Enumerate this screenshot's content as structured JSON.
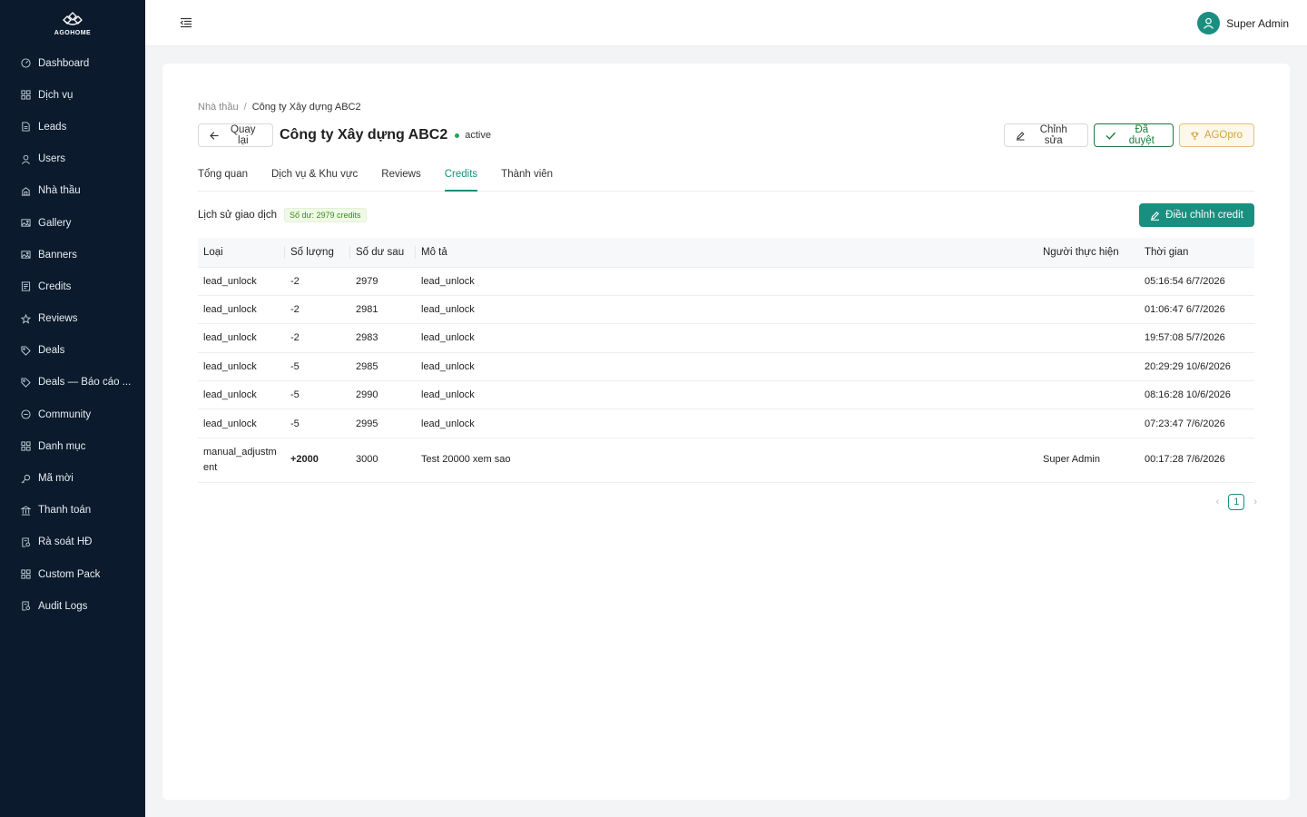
{
  "brand": {
    "name": "AGOHOME"
  },
  "sidebar": {
    "items": [
      {
        "label": "Dashboard",
        "icon": "dashboard-icon"
      },
      {
        "label": "Dịch vụ",
        "icon": "grid-icon"
      },
      {
        "label": "Leads",
        "icon": "file-icon"
      },
      {
        "label": "Users",
        "icon": "user-icon"
      },
      {
        "label": "Nhà thầu",
        "icon": "building-icon"
      },
      {
        "label": "Gallery",
        "icon": "image-icon"
      },
      {
        "label": "Banners",
        "icon": "image-icon"
      },
      {
        "label": "Credits",
        "icon": "credit-icon"
      },
      {
        "label": "Reviews",
        "icon": "star-icon"
      },
      {
        "label": "Deals",
        "icon": "tag-icon"
      },
      {
        "label": "Deals — Báo cáo ...",
        "icon": "tag-icon"
      },
      {
        "label": "Community",
        "icon": "chat-icon"
      },
      {
        "label": "Danh mục",
        "icon": "grid-icon"
      },
      {
        "label": "Mã mời",
        "icon": "key-icon"
      },
      {
        "label": "Thanh toán",
        "icon": "bank-icon"
      },
      {
        "label": "Rà soát HĐ",
        "icon": "audit-icon"
      },
      {
        "label": "Custom Pack",
        "icon": "grid-icon"
      },
      {
        "label": "Audit Logs",
        "icon": "audit-icon"
      }
    ]
  },
  "header": {
    "user_name": "Super Admin"
  },
  "breadcrumb": {
    "parent": "Nhà thầu",
    "separator": "/",
    "current": "Công ty Xây dựng ABC2"
  },
  "page": {
    "back_label": "Quay lại",
    "title": "Công ty Xây dựng ABC2",
    "status": "active",
    "edit_label": "Chỉnh sửa",
    "approved_label": "Đã duyệt",
    "agopro_label": "AGOpro"
  },
  "tabs": [
    {
      "label": "Tổng quan",
      "active": false
    },
    {
      "label": "Dịch vụ & Khu vực",
      "active": false
    },
    {
      "label": "Reviews",
      "active": false
    },
    {
      "label": "Credits",
      "active": true
    },
    {
      "label": "Thành viên",
      "active": false
    }
  ],
  "credits": {
    "section_title": "Lịch sử giao dịch",
    "balance_label": "Số dư: 2979 credits",
    "adjust_label": "Điều chỉnh credit",
    "columns": [
      "Loại",
      "Số lượng",
      "Số dư sau",
      "Mô tả",
      "Người thực hiện",
      "Thời gian"
    ],
    "rows": [
      {
        "type": "lead_unlock",
        "amount": "-2",
        "balance": "2979",
        "desc": "lead_unlock",
        "actor": "",
        "time": "05:16:54 6/7/2026"
      },
      {
        "type": "lead_unlock",
        "amount": "-2",
        "balance": "2981",
        "desc": "lead_unlock",
        "actor": "",
        "time": "01:06:47 6/7/2026"
      },
      {
        "type": "lead_unlock",
        "amount": "-2",
        "balance": "2983",
        "desc": "lead_unlock",
        "actor": "",
        "time": "19:57:08 5/7/2026"
      },
      {
        "type": "lead_unlock",
        "amount": "-5",
        "balance": "2985",
        "desc": "lead_unlock",
        "actor": "",
        "time": "20:29:29 10/6/2026"
      },
      {
        "type": "lead_unlock",
        "amount": "-5",
        "balance": "2990",
        "desc": "lead_unlock",
        "actor": "",
        "time": "08:16:28 10/6/2026"
      },
      {
        "type": "lead_unlock",
        "amount": "-5",
        "balance": "2995",
        "desc": "lead_unlock",
        "actor": "",
        "time": "07:23:47 7/6/2026"
      },
      {
        "type": "manual_adjustment",
        "amount": "+2000",
        "balance": "3000",
        "desc": "Test 20000 xem sao",
        "actor": "Super Admin",
        "time": "00:17:28 7/6/2026"
      }
    ]
  },
  "pagination": {
    "current_page": "1",
    "prev": "‹",
    "next": "›"
  },
  "colors": {
    "sidebar_bg": "#0b1a2c",
    "accent": "#1a8f7f",
    "negative": "#d61f2c",
    "positive": "#1e8a35",
    "status_active": "#22a35a"
  }
}
